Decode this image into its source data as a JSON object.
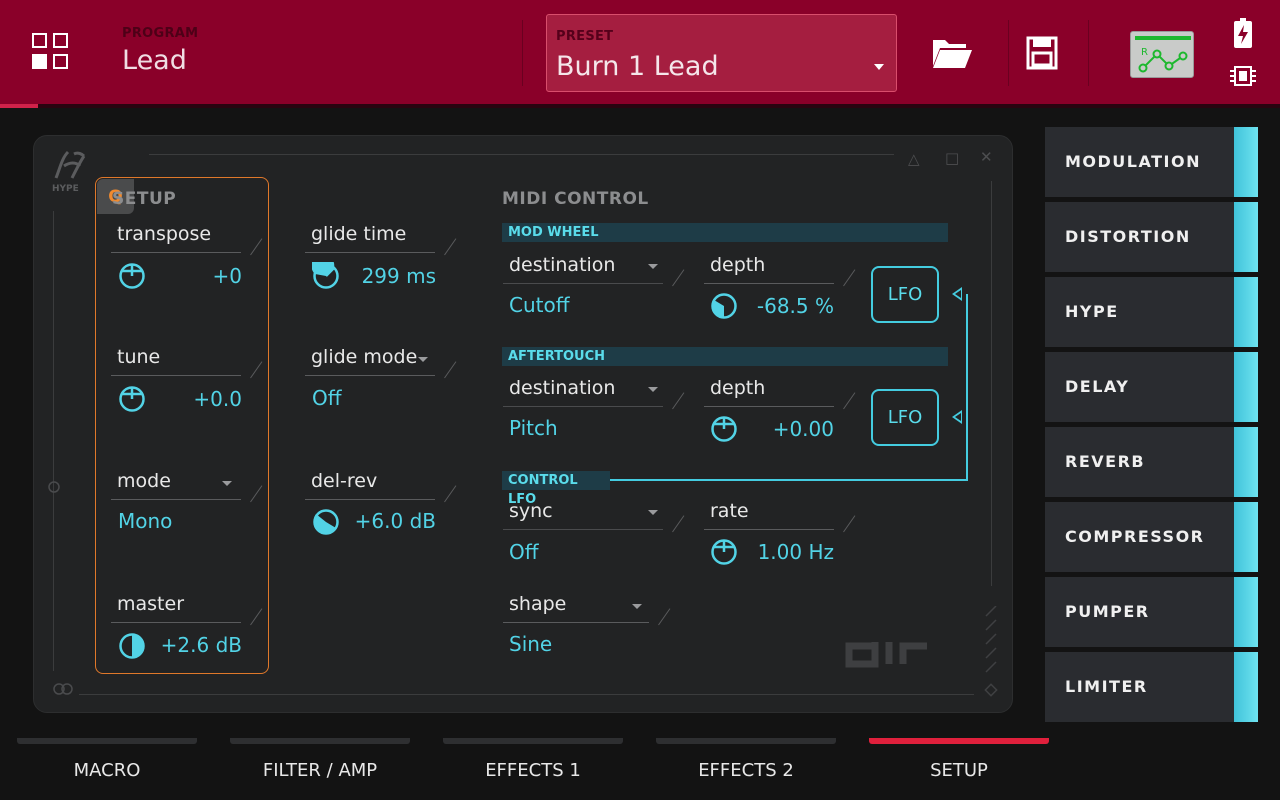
{
  "header": {
    "program_label": "PROGRAM",
    "program_name": "Lead",
    "preset_label": "PRESET",
    "preset_name": "Burn 1 Lead"
  },
  "panel": {
    "brand": "HYPE",
    "setup_title": "SETUP",
    "q_badge": "Q",
    "midi_title": "MIDI CONTROL",
    "setup": {
      "transpose": {
        "label": "transpose",
        "value": "+0"
      },
      "tune": {
        "label": "tune",
        "value": "+0.0"
      },
      "mode": {
        "label": "mode",
        "value": "Mono"
      },
      "master": {
        "label": "master",
        "value": "+2.6 dB"
      }
    },
    "glide": {
      "time": {
        "label": "glide time",
        "value": "299 ms"
      },
      "mode": {
        "label": "glide mode",
        "value": "Off"
      },
      "delrev": {
        "label": "del-rev",
        "value": "+6.0 dB"
      }
    },
    "mod_wheel": {
      "title": "MOD WHEEL",
      "destination_label": "destination",
      "destination_value": "Cutoff",
      "depth_label": "depth",
      "depth_value": "-68.5 %",
      "lfo": "LFO"
    },
    "aftertouch": {
      "title": "AFTERTOUCH",
      "destination_label": "destination",
      "destination_value": "Pitch",
      "depth_label": "depth",
      "depth_value": "+0.00",
      "lfo": "LFO"
    },
    "control_lfo": {
      "title": "CONTROL LFO",
      "sync_label": "sync",
      "sync_value": "Off",
      "rate_label": "rate",
      "rate_value": "1.00 Hz",
      "shape_label": "shape",
      "shape_value": "Sine"
    }
  },
  "effects": [
    "MODULATION",
    "DISTORTION",
    "HYPE",
    "DELAY",
    "REVERB",
    "COMPRESSOR",
    "PUMPER",
    "LIMITER"
  ],
  "tabs": [
    {
      "label": "MACRO",
      "active": false
    },
    {
      "label": "FILTER / AMP",
      "active": false
    },
    {
      "label": "EFFECTS 1",
      "active": false
    },
    {
      "label": "EFFECTS 2",
      "active": false
    },
    {
      "label": "SETUP",
      "active": true
    }
  ],
  "colors": {
    "header": "#8a0029",
    "accent": "#52d3e6",
    "setup_border": "#e0782a",
    "active_tab": "#e0203c"
  },
  "icons": [
    "grid-icon",
    "folder-icon",
    "save-icon",
    "graph-icon",
    "battery-icon",
    "chip-icon"
  ]
}
